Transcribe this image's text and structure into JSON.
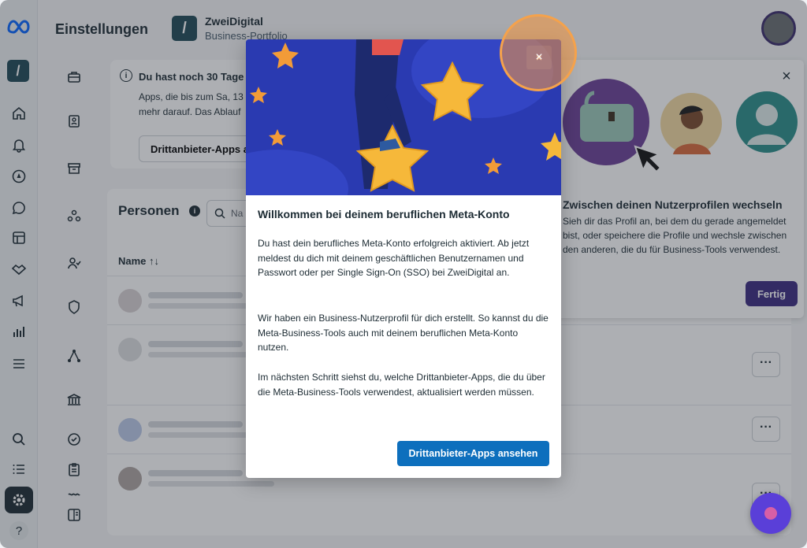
{
  "header": {
    "title": "Einstellungen",
    "portfolio_initial": "/",
    "portfolio_name": "ZweiDigital",
    "portfolio_subtitle": "Business-Portfolio"
  },
  "rail": {
    "biz_initial": "/",
    "help_label": "?"
  },
  "notice": {
    "info_symbol": "i",
    "title": "Du hast noch 30 Tage",
    "text": "Apps, die bis zum Sa, 13 mehr darauf. Das Ablauf",
    "button": "Drittanbieter-Apps a"
  },
  "people": {
    "title": "Personen",
    "info_symbol": "i",
    "search_placeholder": "Na",
    "column_name": "Name ↑↓",
    "more_label": "···"
  },
  "tip": {
    "close": "×",
    "title": "Zwischen deinen Nutzerprofilen wechseln",
    "text": "Sieh dir das Profil an, bei dem du gerade angemeldet bist, oder speichere die Profile und wechsle zwischen den anderen, die du für Business-Tools verwendest.",
    "done_button": "Fertig"
  },
  "modal": {
    "close": "×",
    "title": "Willkommen bei deinem beruflichen Meta-Konto",
    "p1": "Du hast dein berufliches Meta-Konto erfolgreich aktiviert. Ab jetzt meldest du dich mit deinem geschäftlichen Benutzernamen und Passwort oder per Single Sign-On (SSO) bei ZweiDigital an.",
    "p2": "Wir haben ein Business-Nutzerprofil für dich erstellt. So kannst du die Meta-Business-Tools auch mit deinem beruflichen Meta-Konto nutzen.",
    "p3": "Im nächsten Schritt siehst du, welche Drittanbieter-Apps, die du über die Meta-Business-Tools verwendest, aktualisiert werden müssen.",
    "button": "Drittanbieter-Apps ansehen"
  },
  "colors": {
    "primary_button": "#0d6fbd",
    "done_button": "#3a2a80",
    "hero_bg": "#2a3ab1",
    "focus_ring": "#f5a24b"
  }
}
